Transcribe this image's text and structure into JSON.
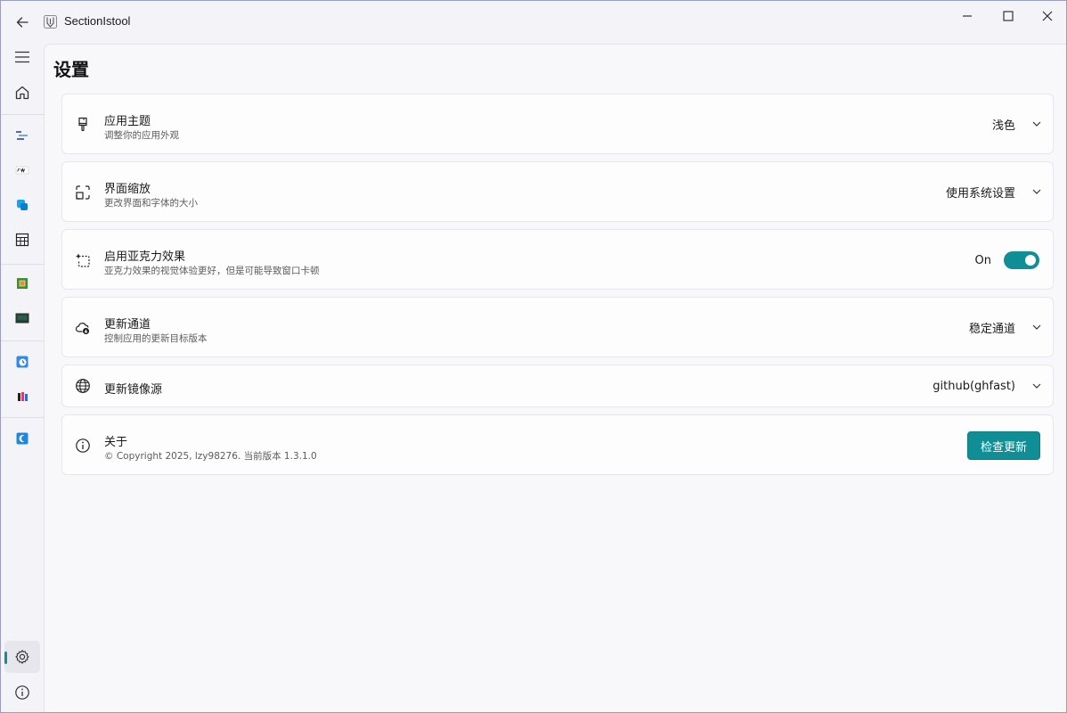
{
  "window": {
    "title": "SectionIstool"
  },
  "page": {
    "title": "设置"
  },
  "settings": {
    "theme": {
      "title": "应用主题",
      "subtitle": "调整你的应用外观",
      "value": "浅色",
      "icon": "brush-icon"
    },
    "scale": {
      "title": "界面缩放",
      "subtitle": "更改界面和字体的大小",
      "value": "使用系统设置",
      "icon": "zoom-icon"
    },
    "acrylic": {
      "title": "启用亚克力效果",
      "subtitle": "亚克力效果的视觉体验更好，但是可能导致窗口卡顿",
      "state_label": "On",
      "enabled": true,
      "icon": "sparkle-icon"
    },
    "channel": {
      "title": "更新通道",
      "subtitle": "控制应用的更新目标版本",
      "value": "稳定通道",
      "icon": "cloud-icon"
    },
    "mirror": {
      "title": "更新镜像源",
      "value": "github(ghfast)",
      "icon": "globe-icon"
    },
    "about": {
      "title": "关于",
      "subtitle": "© Copyright 2025, lzy98276. 当前版本 1.3.1.0",
      "button_label": "检查更新",
      "icon": "info-icon"
    }
  },
  "colors": {
    "accent": "#0f8e95"
  }
}
